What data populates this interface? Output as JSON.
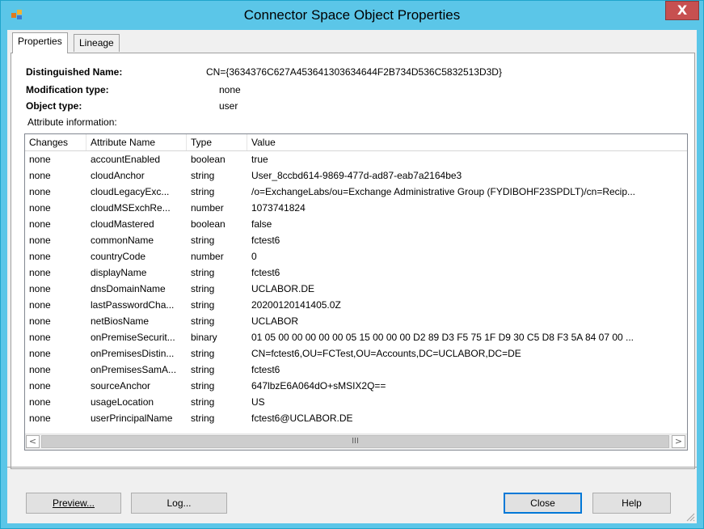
{
  "window": {
    "title": "Connector Space Object Properties",
    "close_label": "X"
  },
  "tabs": [
    {
      "label": "Properties",
      "active": true
    },
    {
      "label": "Lineage",
      "active": false
    }
  ],
  "summary": {
    "dn_label": "Distinguished Name:",
    "dn_value": "CN={3634376C627A453641303634644F2B734D536C5832513D3D}",
    "mod_label": "Modification type:",
    "mod_value": "none",
    "type_label": "Object type:",
    "type_value": "user",
    "attr_info_label": "Attribute information:"
  },
  "table": {
    "columns": [
      "Changes",
      "Attribute Name",
      "Type",
      "Value"
    ],
    "rows": [
      [
        "none",
        "accountEnabled",
        "boolean",
        "true"
      ],
      [
        "none",
        "cloudAnchor",
        "string",
        "User_8ccbd614-9869-477d-ad87-eab7a2164be3"
      ],
      [
        "none",
        "cloudLegacyExc...",
        "string",
        "/o=ExchangeLabs/ou=Exchange Administrative Group (FYDIBOHF23SPDLT)/cn=Recip..."
      ],
      [
        "none",
        "cloudMSExchRe...",
        "number",
        "1073741824"
      ],
      [
        "none",
        "cloudMastered",
        "boolean",
        "false"
      ],
      [
        "none",
        "commonName",
        "string",
        "fctest6"
      ],
      [
        "none",
        "countryCode",
        "number",
        "0"
      ],
      [
        "none",
        "displayName",
        "string",
        "fctest6"
      ],
      [
        "none",
        "dnsDomainName",
        "string",
        "UCLABOR.DE"
      ],
      [
        "none",
        "lastPasswordCha...",
        "string",
        "20200120141405.0Z"
      ],
      [
        "none",
        "netBiosName",
        "string",
        "UCLABOR"
      ],
      [
        "none",
        "onPremiseSecurit...",
        "binary",
        "01 05 00 00 00 00 00 05 15 00 00 00 D2 89 D3 F5 75 1F D9 30 C5 D8 F3 5A 84 07 00 ..."
      ],
      [
        "none",
        "onPremisesDistin...",
        "string",
        "CN=fctest6,OU=FCTest,OU=Accounts,DC=UCLABOR,DC=DE"
      ],
      [
        "none",
        "onPremisesSamA...",
        "string",
        "fctest6"
      ],
      [
        "none",
        "sourceAnchor",
        "string",
        "647lbzE6A064dO+sMSIX2Q=="
      ],
      [
        "none",
        "usageLocation",
        "string",
        "US"
      ],
      [
        "none",
        "userPrincipalName",
        "string",
        "fctest6@UCLABOR.DE"
      ]
    ]
  },
  "scrollbar": {
    "left_arrow": "<",
    "right_arrow": ">",
    "thumb_grip": "III"
  },
  "buttons": {
    "preview": "Preview...",
    "log": "Log...",
    "close": "Close",
    "help": "Help"
  },
  "colors": {
    "titlebar": "#5bc6e8",
    "close_button": "#c75050",
    "dialog_bg": "#f0f0f0"
  }
}
